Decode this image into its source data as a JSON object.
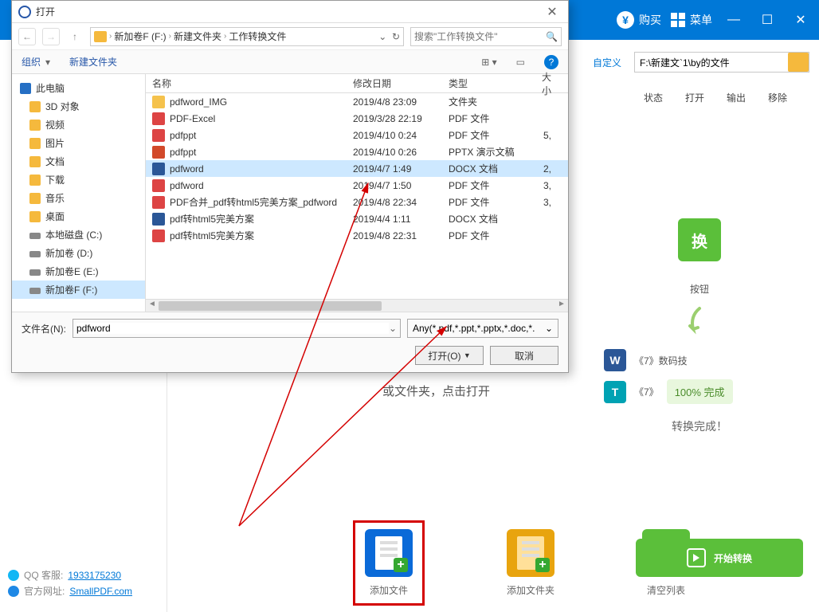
{
  "app_header": {
    "buy": "购买",
    "menu": "菜单"
  },
  "app_toolbar": {
    "custom": "自定义",
    "path": "F:\\新建文`1\\by的文件",
    "cols": {
      "status": "状态",
      "open": "打开",
      "output": "输出",
      "remove": "移除"
    }
  },
  "hint": "或文件夹，点击打开",
  "conv": {
    "btn": "换",
    "under": "按钮",
    "row1": "《7》数码技",
    "row2": "《7》",
    "badge": "100%   完成",
    "done": "转换完成！"
  },
  "actions": {
    "add_file": "添加文件",
    "add_folder": "添加文件夹",
    "clear_list": "清空列表",
    "start": "开始转换"
  },
  "footer_links": {
    "qq_label": "QQ 客服:",
    "qq_num": "1933175230",
    "site_label": "官方网址:",
    "site_url": "SmallPDF.com"
  },
  "dialog": {
    "title": "打开",
    "breadcrumb": [
      "新加卷F (F:)",
      "新建文件夹",
      "工作转换文件"
    ],
    "search_placeholder": "搜索\"工作转换文件\"",
    "toolbar": {
      "organize": "组织",
      "new_folder": "新建文件夹"
    },
    "tree": [
      {
        "label": "此电脑",
        "icon": "pc",
        "root": true
      },
      {
        "label": "3D 对象",
        "icon": "obj"
      },
      {
        "label": "视频",
        "icon": "vid"
      },
      {
        "label": "图片",
        "icon": "img"
      },
      {
        "label": "文档",
        "icon": "doc"
      },
      {
        "label": "下载",
        "icon": "dl"
      },
      {
        "label": "音乐",
        "icon": "mus"
      },
      {
        "label": "桌面",
        "icon": "desk"
      },
      {
        "label": "本地磁盘 (C:)",
        "icon": "disk"
      },
      {
        "label": "新加卷 (D:)",
        "icon": "disk"
      },
      {
        "label": "新加卷E (E:)",
        "icon": "disk"
      },
      {
        "label": "新加卷F (F:)",
        "icon": "disk",
        "sel": true
      }
    ],
    "columns": {
      "name": "名称",
      "date": "修改日期",
      "type": "类型",
      "size": "大小"
    },
    "files": [
      {
        "name": "pdfword_IMG",
        "date": "2019/4/8 23:09",
        "type": "文件夹",
        "size": "",
        "icon": "folder"
      },
      {
        "name": "PDF-Excel",
        "date": "2019/3/28 22:19",
        "type": "PDF 文件",
        "size": "",
        "icon": "pdf"
      },
      {
        "name": "pdfppt",
        "date": "2019/4/10 0:24",
        "type": "PDF 文件",
        "size": "5,",
        "icon": "pdf"
      },
      {
        "name": "pdfppt",
        "date": "2019/4/10 0:26",
        "type": "PPTX 演示文稿",
        "size": "",
        "icon": "pptx"
      },
      {
        "name": "pdfword",
        "date": "2019/4/7 1:49",
        "type": "DOCX 文档",
        "size": "2,",
        "icon": "docx",
        "sel": true
      },
      {
        "name": "pdfword",
        "date": "2019/4/7 1:50",
        "type": "PDF 文件",
        "size": "3,",
        "icon": "pdf"
      },
      {
        "name": "PDF合并_pdf转html5完美方案_pdfword",
        "date": "2019/4/8 22:34",
        "type": "PDF 文件",
        "size": "3,",
        "icon": "pdf"
      },
      {
        "name": "pdf转html5完美方案",
        "date": "2019/4/4 1:11",
        "type": "DOCX 文档",
        "size": "",
        "icon": "docx"
      },
      {
        "name": "pdf转html5完美方案",
        "date": "2019/4/8 22:31",
        "type": "PDF 文件",
        "size": "",
        "icon": "pdf"
      }
    ],
    "filename_label": "文件名(N):",
    "filename_value": "pdfword",
    "filter": "Any(*.pdf,*.ppt,*.pptx,*.doc,*.",
    "open_btn": "打开(O)",
    "cancel_btn": "取消"
  }
}
